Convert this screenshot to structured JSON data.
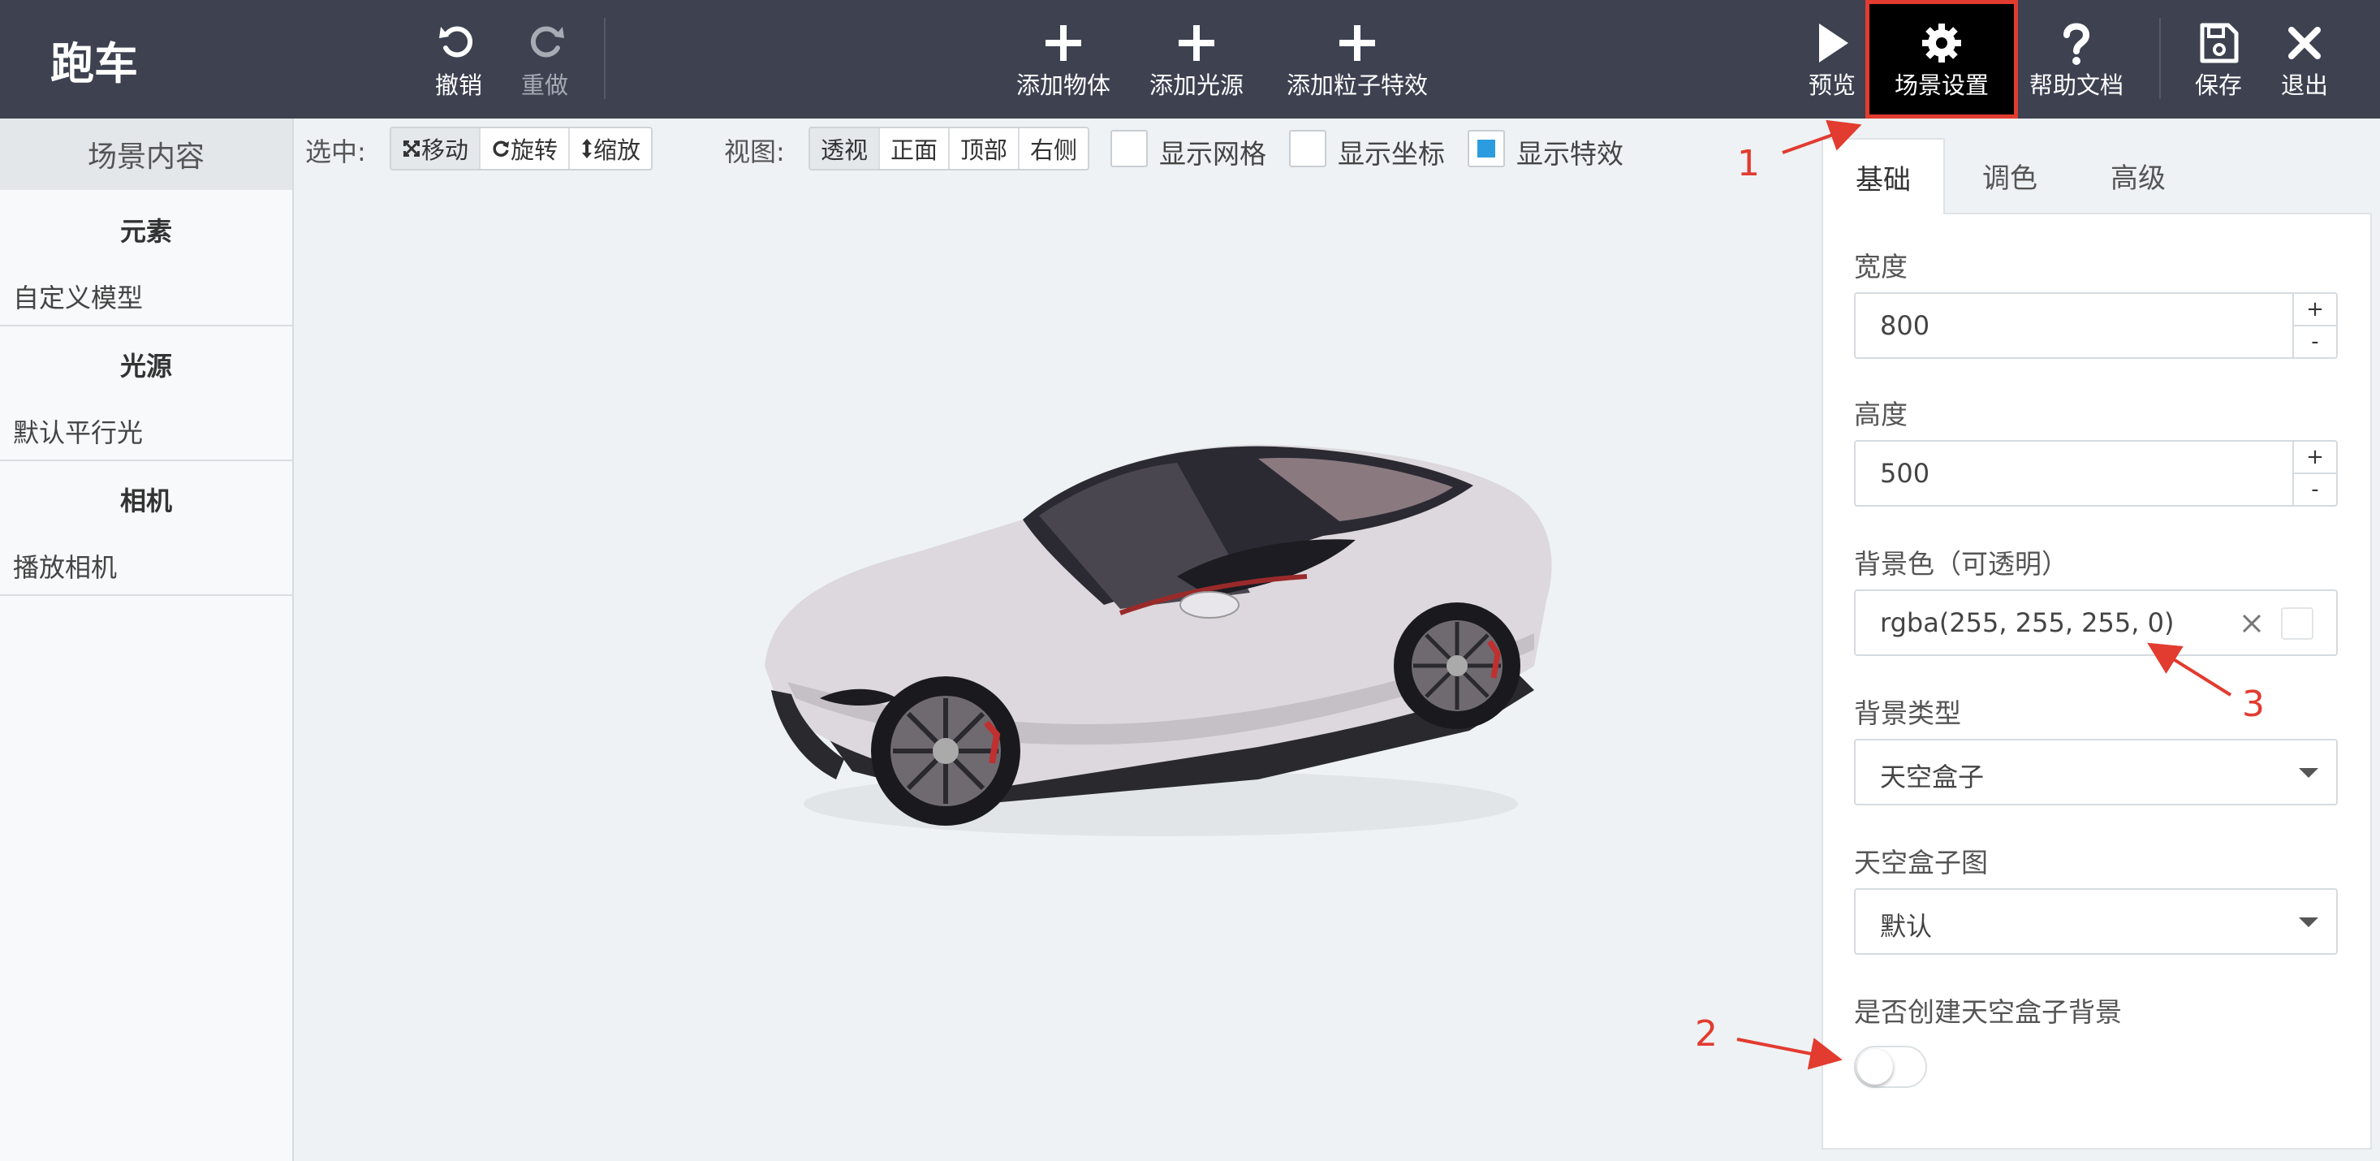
{
  "app": {
    "title": "跑车"
  },
  "toolbar": {
    "undo": "撤销",
    "redo": "重做",
    "add_object": "添加物体",
    "add_light": "添加光源",
    "add_particle": "添加粒子特效",
    "preview": "预览",
    "scene_settings": "场景设置",
    "help": "帮助文档",
    "save": "保存",
    "exit": "退出"
  },
  "sidebar": {
    "header": "场景内容",
    "groups": [
      {
        "title": "元素",
        "items": [
          "自定义模型"
        ]
      },
      {
        "title": "光源",
        "items": [
          "默认平行光"
        ]
      },
      {
        "title": "相机",
        "items": [
          "播放相机"
        ]
      }
    ]
  },
  "viewport_toolbar": {
    "select_label": "选中:",
    "transform_modes": [
      {
        "label": "移动",
        "icon": "move-icon",
        "active": true
      },
      {
        "label": "旋转",
        "icon": "rotate-icon",
        "active": false
      },
      {
        "label": "缩放",
        "icon": "scale-icon",
        "active": false
      }
    ],
    "view_label": "视图:",
    "views": [
      {
        "label": "透视",
        "active": true
      },
      {
        "label": "正面",
        "active": false
      },
      {
        "label": "顶部",
        "active": false
      },
      {
        "label": "右侧",
        "active": false
      }
    ],
    "checkboxes": [
      {
        "label": "显示网格",
        "checked": false
      },
      {
        "label": "显示坐标",
        "checked": false
      },
      {
        "label": "显示特效",
        "checked": true
      }
    ]
  },
  "settings_panel": {
    "tabs": [
      "基础",
      "调色",
      "高级"
    ],
    "active_tab": "基础",
    "width_label": "宽度",
    "width_value": "800",
    "height_label": "高度",
    "height_value": "500",
    "stepper_plus": "+",
    "stepper_minus": "-",
    "bg_color_label": "背景色（可透明）",
    "bg_color_value": "rgba(255, 255, 255, 0)",
    "bg_type_label": "背景类型",
    "bg_type_value": "天空盒子",
    "skybox_label": "天空盒子图",
    "skybox_value": "默认",
    "create_skybox_bg_label": "是否创建天空盒子背景",
    "create_skybox_bg_enabled": false
  },
  "annotations": [
    "1",
    "2",
    "3"
  ],
  "colors": {
    "topbar": "#3d4150",
    "annotation": "#e23b2f",
    "checkbox_checked": "#2c9ce0",
    "car_body": "#dcd8dd"
  }
}
